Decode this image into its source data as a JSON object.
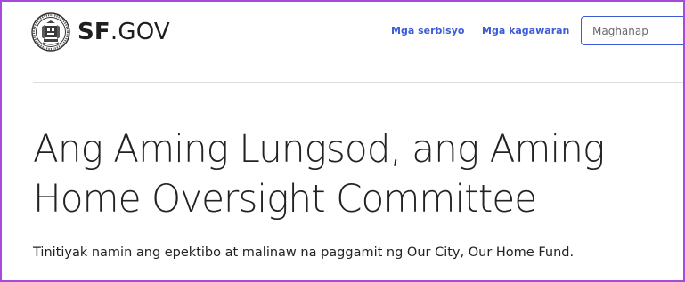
{
  "header": {
    "logo": {
      "wordmark_bold": "SF",
      "wordmark_light": ".GOV",
      "seal_icon": "city-seal-icon"
    },
    "nav": {
      "services_label": "Mga serbisyo",
      "departments_label": "Mga kagawaran"
    },
    "search": {
      "placeholder": "Maghanap",
      "value": ""
    }
  },
  "main": {
    "title_line1": "Ang Aming Lungsod, ang Aming",
    "title_line2": "Home Oversight Committee",
    "description": "Tinitiyak namin ang epektibo at malinaw na paggamit ng Our City, Our Home Fund."
  },
  "colors": {
    "link": "#3c5bd8",
    "text": "#222222",
    "frame_border": "#a64ad9",
    "divider": "#dddddd"
  }
}
